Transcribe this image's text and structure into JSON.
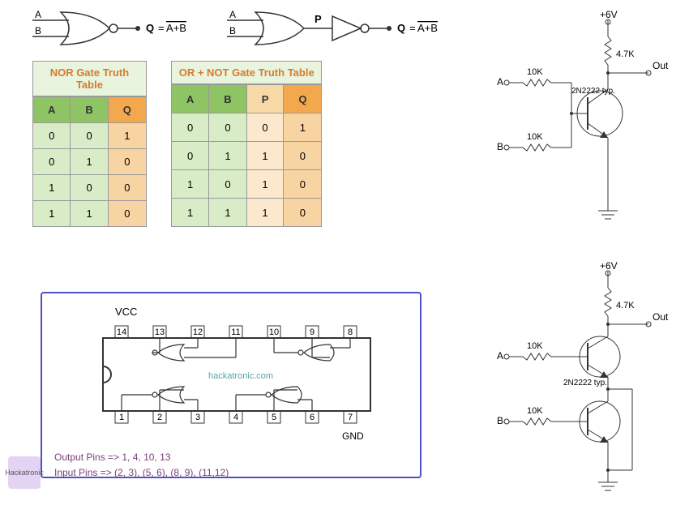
{
  "gates": {
    "nor": {
      "inputs": [
        "A",
        "B"
      ],
      "output": "Q",
      "expr_lhs": "Q",
      "expr_rhs": "A+B"
    },
    "ornot": {
      "inputs": [
        "A",
        "B"
      ],
      "mid": "P",
      "output": "Q",
      "expr_lhs": "Q",
      "expr_rhs": "A+B"
    }
  },
  "tables": {
    "nor": {
      "title": "NOR Gate Truth Table",
      "headers": [
        "A",
        "B",
        "Q"
      ],
      "rows": [
        [
          "0",
          "0",
          "1"
        ],
        [
          "0",
          "1",
          "0"
        ],
        [
          "1",
          "0",
          "0"
        ],
        [
          "1",
          "1",
          "0"
        ]
      ]
    },
    "ornot": {
      "title": "OR + NOT Gate Truth Table",
      "headers": [
        "A",
        "B",
        "P",
        "Q"
      ],
      "rows": [
        [
          "0",
          "0",
          "0",
          "1"
        ],
        [
          "0",
          "1",
          "1",
          "0"
        ],
        [
          "1",
          "0",
          "1",
          "0"
        ],
        [
          "1",
          "1",
          "1",
          "0"
        ]
      ]
    }
  },
  "ic": {
    "vcc": "VCC",
    "gnd": "GND",
    "top_pins": [
      "14",
      "13",
      "12",
      "11",
      "10",
      "9",
      "8"
    ],
    "bottom_pins": [
      "1",
      "2",
      "3",
      "4",
      "5",
      "6",
      "7"
    ],
    "watermark": "hackatronic.com",
    "output_line": "Output Pins => 1, 4, 10, 13",
    "input_line": "Input Pins => (2, 3), (5, 6), (8, 9), (11,12)"
  },
  "circuit1": {
    "supply": "+6V",
    "r_pullup": "4.7K",
    "out": "Out",
    "r_a": "10K",
    "r_b": "10K",
    "in_a": "A",
    "in_b": "B",
    "transistor": "2N2222\ntyp."
  },
  "circuit2": {
    "supply": "+6V",
    "r_pullup": "4.7K",
    "out": "Out",
    "r_a": "10K",
    "r_b": "10K",
    "in_a": "A",
    "in_b": "B",
    "transistor": "2N2222\ntyp."
  },
  "logo": "Hackatronic"
}
